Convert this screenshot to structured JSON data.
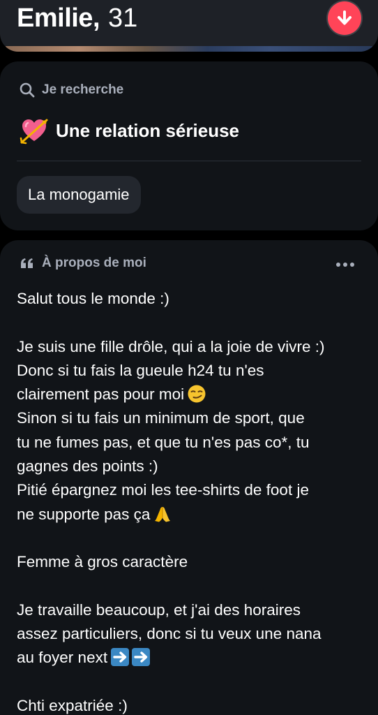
{
  "profile": {
    "name": "Emilie,",
    "age": "31"
  },
  "looking_for": {
    "header": "Je recherche",
    "value": "Une relation sérieuse",
    "chip": "La monogamie"
  },
  "about": {
    "header": "À propos de moi",
    "lines": [
      "Salut tous le monde :)",
      "",
      "Je suis une fille drôle, qui a la joie de vivre :)",
      "Donc si tu fais la gueule h24 tu n'es",
      "clairement pas pour moi",
      "Sinon si tu fais un minimum de sport, que",
      "tu ne fumes pas, et que tu n'es pas co*, tu",
      "gagnes des points :)",
      "Pitié épargnez moi les tee-shirts de foot je",
      "ne supporte pas ça",
      "",
      "Femme à gros caractère",
      "",
      "Je travaille beaucoup, et j'ai des horaires",
      "assez particuliers, donc si tu veux une nana",
      "au foyer next",
      "",
      "Chti expatriée :)"
    ]
  },
  "icons": {
    "down": "arrow-down-icon",
    "search": "search-icon",
    "heart": "heart-with-arrow-icon",
    "quote": "quote-icon",
    "more": "more-dots-icon",
    "smirk": "smirking-face-icon",
    "pray": "folded-hands-icon",
    "right_arrow": "right-arrow-icon"
  },
  "colors": {
    "accent": "#ff4458",
    "card": "#111418",
    "muted": "#a9afbb"
  }
}
